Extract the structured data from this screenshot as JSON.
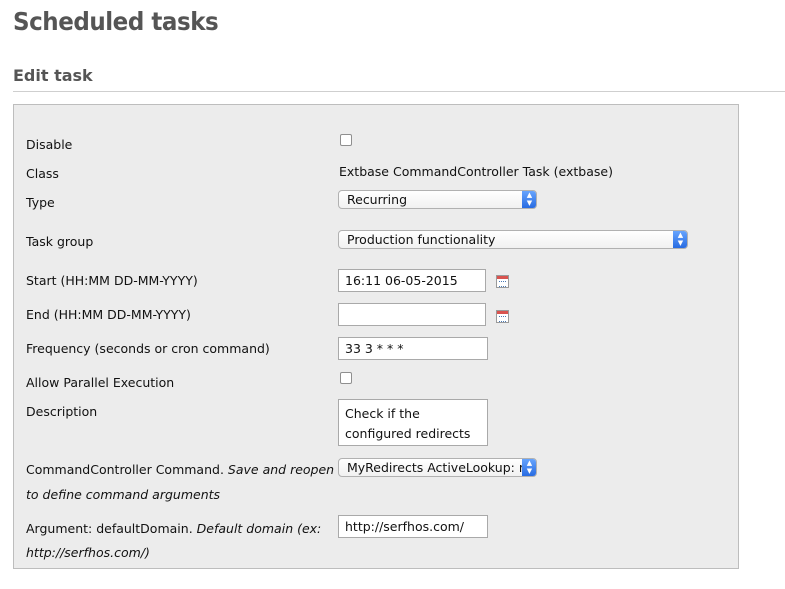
{
  "page": {
    "title": "Scheduled tasks"
  },
  "section": {
    "title": "Edit task"
  },
  "form": {
    "disable": {
      "label": "Disable",
      "checked": false
    },
    "class": {
      "label": "Class",
      "value": "Extbase CommandController Task (extbase)"
    },
    "type": {
      "label": "Type",
      "value": "Recurring"
    },
    "task_group": {
      "label": "Task group",
      "value": "Production functionality"
    },
    "start": {
      "label": "Start (HH:MM DD-MM-YYYY)",
      "value": "16:11 06-05-2015"
    },
    "end": {
      "label": "End (HH:MM DD-MM-YYYY)",
      "value": ""
    },
    "frequency": {
      "label": "Frequency (seconds or cron command)",
      "value": "33 3 * * *"
    },
    "parallel": {
      "label": "Allow Parallel Execution",
      "checked": false
    },
    "description": {
      "label": "Description",
      "value_line1": "Check if the",
      "value_line2": "configured redirects"
    },
    "command": {
      "label_plain": "CommandController Command.",
      "label_italic1": "Save and reopen",
      "label_italic2": "to define command arguments",
      "value": "MyRedirects ActiveLookup: r"
    },
    "argument": {
      "label_plain": "Argument: defaultDomain.",
      "label_italic1": "Default domain (ex:",
      "label_italic2": "http://serfhos.com/)",
      "value": "http://serfhos.com/"
    }
  },
  "icons": {
    "calendar": "calendar-icon",
    "select_arrow": "chevron-updown-icon"
  },
  "colors": {
    "select_accent": "#2468e0",
    "panel_bg": "#ececec"
  }
}
